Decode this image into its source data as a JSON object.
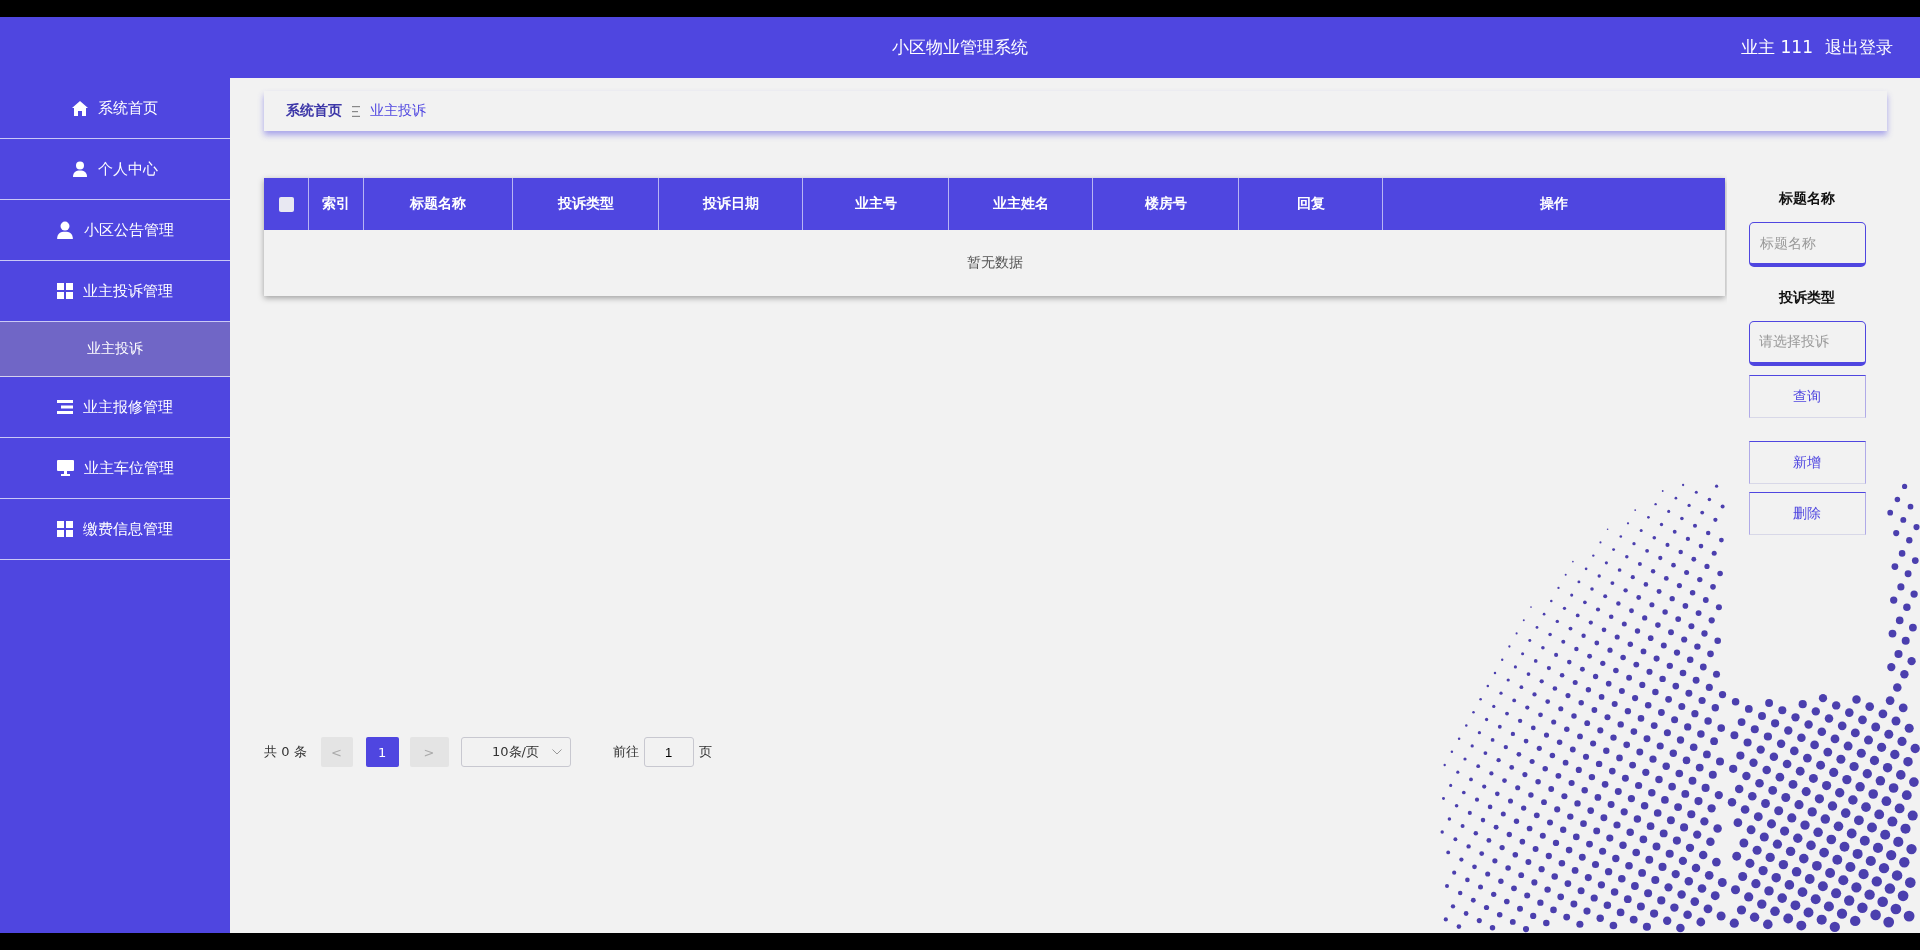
{
  "header": {
    "title": "小区物业管理系统",
    "user": "业主 111",
    "logout": "退出登录"
  },
  "sidebar": {
    "items": [
      {
        "label": "系统首页",
        "selected": false
      },
      {
        "label": "个人中心",
        "selected": false
      },
      {
        "label": "小区公告管理",
        "selected": false
      },
      {
        "label": "业主投诉管理",
        "selected": false,
        "expanded": true,
        "children": [
          {
            "label": "业主投诉",
            "selected": true
          }
        ]
      },
      {
        "label": "业主报修管理",
        "selected": false
      },
      {
        "label": "业主车位管理",
        "selected": false
      },
      {
        "label": "缴费信息管理",
        "selected": false
      }
    ]
  },
  "breadcrumb": [
    {
      "label": "系统首页",
      "current": false
    },
    {
      "label": "业主投诉",
      "current": true
    }
  ],
  "table": {
    "select_all": {
      "checked": false
    },
    "columns": [
      "索引",
      "标题名称",
      "投诉类型",
      "投诉日期",
      "业主号",
      "业主姓名",
      "楼房号",
      "回复",
      "操作"
    ],
    "empty_text": "暂无数据"
  },
  "pagination": {
    "total": "共 0 条",
    "prev": {
      "label": "<",
      "disabled": true
    },
    "pages": [
      {
        "label": "1",
        "selected": true
      }
    ],
    "next": {
      "label": ">",
      "disabled": true
    },
    "page_size": "10条/页",
    "goto_label": "前往",
    "goto_value": "1",
    "goto_suffix": "页"
  },
  "search": {
    "fields": [
      {
        "kind": "input",
        "label": "标题名称",
        "placeholder": "标题名称"
      },
      {
        "kind": "select",
        "label": "投诉类型",
        "placeholder": "请选择投诉"
      }
    ],
    "buttons": [
      "查询",
      "新增",
      "删除"
    ]
  }
}
